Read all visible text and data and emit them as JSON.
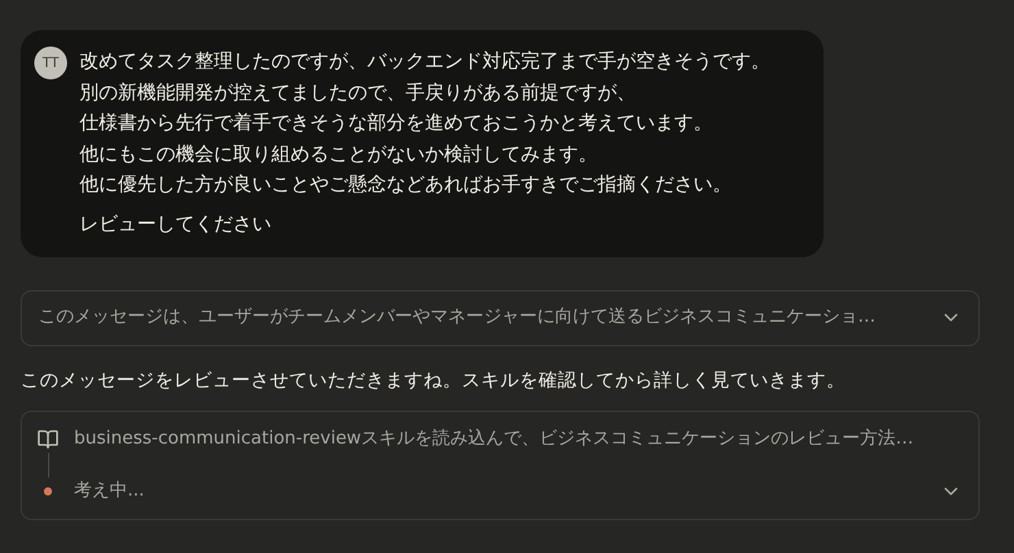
{
  "user_message": {
    "avatar": "TT",
    "lines": [
      "改めてタスク整理したのですが、バックエンド対応完了まで手が空きそうです。",
      "別の新機能開発が控えてましたので、手戻りがある前提ですが、",
      "仕様書から先行で着手できそうな部分を進めておこうかと考えています。",
      "他にもこの機会に取り組めることがないか検討してみます。",
      "他に優先した方が良いことやご懸念などあればお手すきでご指摘ください。"
    ],
    "request": "レビューしてください"
  },
  "summary": {
    "text": "このメッセージは、ユーザーがチームメンバーやマネージャーに向けて送るビジネスコミュニケーショ…",
    "expanded": false
  },
  "reply": "このメッセージをレビューさせていただきますね。スキルを確認してから詳しく見ていきます。",
  "activity": {
    "expanded": false,
    "steps": [
      {
        "kind": "tool",
        "text": "business-communication-reviewスキルを読み込んで、ビジネスコミュニケーションのレビュー方法…"
      },
      {
        "kind": "thinking",
        "text": "考え中..."
      }
    ]
  }
}
